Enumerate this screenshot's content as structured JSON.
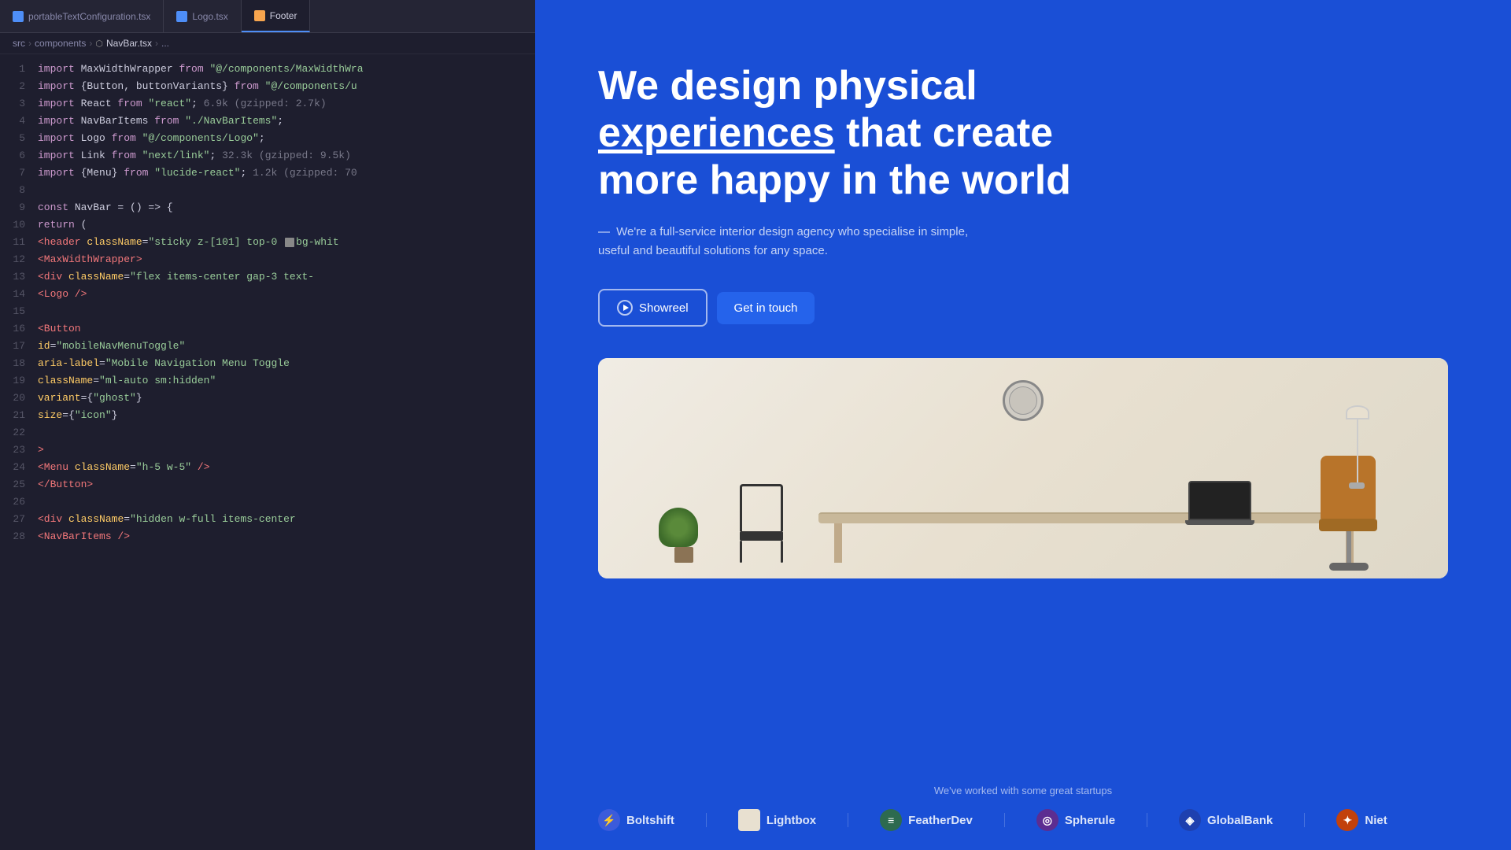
{
  "editor": {
    "tabs": [
      {
        "label": "portableTextConfiguration.tsx",
        "type": "tsx",
        "active": false
      },
      {
        "label": "Logo.tsx",
        "type": "tsx",
        "active": false
      },
      {
        "label": "Footer",
        "type": "partial",
        "active": true
      }
    ],
    "breadcrumb": {
      "parts": [
        "src",
        "components",
        "NavBar.tsx",
        "..."
      ]
    },
    "lines": [
      {
        "num": "1",
        "tokens": [
          {
            "t": "kw",
            "v": "import"
          },
          {
            "t": "cls",
            "v": " MaxWidthWrapper "
          },
          {
            "t": "kw",
            "v": "from"
          },
          {
            "t": "str",
            "v": " \"@/components/MaxWidthWra"
          }
        ]
      },
      {
        "num": "2",
        "tokens": [
          {
            "t": "kw",
            "v": "import"
          },
          {
            "t": "cls",
            "v": " {Button, buttonVariants} "
          },
          {
            "t": "kw",
            "v": "from"
          },
          {
            "t": "str",
            "v": " \"@/components/u"
          }
        ]
      },
      {
        "num": "3",
        "tokens": [
          {
            "t": "kw",
            "v": "import"
          },
          {
            "t": "cls",
            "v": " React "
          },
          {
            "t": "kw",
            "v": "from"
          },
          {
            "t": "str",
            "v": " \"react\""
          },
          {
            "t": "cmt",
            "v": ";  6.9k (gzipped: 2.7k)"
          }
        ]
      },
      {
        "num": "4",
        "tokens": [
          {
            "t": "kw",
            "v": "import"
          },
          {
            "t": "cls",
            "v": " NavBarItems "
          },
          {
            "t": "kw",
            "v": "from"
          },
          {
            "t": "str",
            "v": " \"./NavBarItems\""
          },
          {
            "t": "cls",
            "v": ";"
          }
        ]
      },
      {
        "num": "5",
        "tokens": [
          {
            "t": "kw",
            "v": "import"
          },
          {
            "t": "cls",
            "v": " Logo "
          },
          {
            "t": "kw",
            "v": "from"
          },
          {
            "t": "str",
            "v": " \"@/components/Logo\""
          },
          {
            "t": "cls",
            "v": ";"
          }
        ]
      },
      {
        "num": "6",
        "tokens": [
          {
            "t": "kw",
            "v": "import"
          },
          {
            "t": "cls",
            "v": " Link "
          },
          {
            "t": "kw",
            "v": "from"
          },
          {
            "t": "str",
            "v": " \"next/link\""
          },
          {
            "t": "cmt",
            "v": ";  32.3k (gzipped: 9.5k)"
          }
        ]
      },
      {
        "num": "7",
        "tokens": [
          {
            "t": "kw",
            "v": "import"
          },
          {
            "t": "cls",
            "v": " {Menu} "
          },
          {
            "t": "kw",
            "v": "from"
          },
          {
            "t": "str",
            "v": " \"lucide-react\""
          },
          {
            "t": "cmt",
            "v": ";  1.2k (gzipped: 70"
          }
        ]
      },
      {
        "num": "8",
        "tokens": []
      },
      {
        "num": "9",
        "tokens": [
          {
            "t": "kw",
            "v": "const"
          },
          {
            "t": "cls",
            "v": " NavBar "
          },
          {
            "t": "kw",
            "v": "= () =>"
          },
          {
            "t": "cls",
            "v": " {"
          }
        ]
      },
      {
        "num": "10",
        "tokens": [
          {
            "t": "cls",
            "v": "    "
          },
          {
            "t": "kw",
            "v": "return"
          },
          {
            "t": "cls",
            "v": " ("
          }
        ]
      },
      {
        "num": "11",
        "tokens": [
          {
            "t": "cls",
            "v": "        "
          },
          {
            "t": "tag",
            "v": "<header"
          },
          {
            "t": "cls",
            "v": " "
          },
          {
            "t": "attr",
            "v": "className"
          },
          {
            "t": "cls",
            "v": "="
          },
          {
            "t": "str",
            "v": "\"sticky z-[101] top-0  bg-whit"
          }
        ]
      },
      {
        "num": "12",
        "tokens": [
          {
            "t": "cls",
            "v": "            "
          },
          {
            "t": "tag",
            "v": "<MaxWidthWrapper"
          },
          {
            "t": "tag",
            "v": ">"
          }
        ]
      },
      {
        "num": "13",
        "tokens": [
          {
            "t": "cls",
            "v": "                "
          },
          {
            "t": "tag",
            "v": "<div"
          },
          {
            "t": "cls",
            "v": " "
          },
          {
            "t": "attr",
            "v": "className"
          },
          {
            "t": "cls",
            "v": "="
          },
          {
            "t": "str",
            "v": "\"flex items-center gap-3 text-"
          }
        ]
      },
      {
        "num": "14",
        "tokens": [
          {
            "t": "cls",
            "v": "                    "
          },
          {
            "t": "tag",
            "v": "<Logo"
          },
          {
            "t": "cls",
            "v": " "
          },
          {
            "t": "tag",
            "v": "/>"
          }
        ]
      },
      {
        "num": "15",
        "tokens": []
      },
      {
        "num": "16",
        "tokens": [
          {
            "t": "cls",
            "v": "                "
          },
          {
            "t": "tag",
            "v": "<Button"
          }
        ]
      },
      {
        "num": "17",
        "tokens": [
          {
            "t": "cls",
            "v": "                    "
          },
          {
            "t": "attr",
            "v": "id"
          },
          {
            "t": "cls",
            "v": "="
          },
          {
            "t": "str",
            "v": "\"mobileNavMenuToggle\""
          }
        ]
      },
      {
        "num": "18",
        "tokens": [
          {
            "t": "cls",
            "v": "                    "
          },
          {
            "t": "attr",
            "v": "aria-label"
          },
          {
            "t": "cls",
            "v": "="
          },
          {
            "t": "str",
            "v": "\"Mobile Navigation Menu Toggle"
          }
        ]
      },
      {
        "num": "19",
        "tokens": [
          {
            "t": "cls",
            "v": "                    "
          },
          {
            "t": "attr",
            "v": "className"
          },
          {
            "t": "cls",
            "v": "="
          },
          {
            "t": "str",
            "v": "\"ml-auto sm:hidden\""
          }
        ]
      },
      {
        "num": "20",
        "tokens": [
          {
            "t": "cls",
            "v": "                    "
          },
          {
            "t": "attr",
            "v": "variant"
          },
          {
            "t": "cls",
            "v": "={"
          },
          {
            "t": "str",
            "v": "\"ghost\""
          },
          {
            "t": "cls",
            "v": "}"
          }
        ]
      },
      {
        "num": "21",
        "tokens": [
          {
            "t": "cls",
            "v": "                    "
          },
          {
            "t": "attr",
            "v": "size"
          },
          {
            "t": "cls",
            "v": "={"
          },
          {
            "t": "str",
            "v": "\"icon\""
          },
          {
            "t": "cls",
            "v": "}"
          }
        ]
      },
      {
        "num": "22",
        "tokens": []
      },
      {
        "num": "23",
        "tokens": [
          {
            "t": "cls",
            "v": "                "
          },
          {
            "t": "tag",
            "v": ">"
          }
        ]
      },
      {
        "num": "24",
        "tokens": [
          {
            "t": "cls",
            "v": "                "
          },
          {
            "t": "tag",
            "v": "<Menu"
          },
          {
            "t": "cls",
            "v": " "
          },
          {
            "t": "attr",
            "v": "className"
          },
          {
            "t": "cls",
            "v": "="
          },
          {
            "t": "str",
            "v": "\"h-5 w-5\""
          },
          {
            "t": "cls",
            "v": " "
          },
          {
            "t": "tag",
            "v": "/>"
          }
        ]
      },
      {
        "num": "25",
        "tokens": [
          {
            "t": "cls",
            "v": "                "
          },
          {
            "t": "tag",
            "v": "</Button>"
          }
        ]
      },
      {
        "num": "26",
        "tokens": []
      },
      {
        "num": "27",
        "tokens": [
          {
            "t": "cls",
            "v": "                "
          },
          {
            "t": "tag",
            "v": "<div"
          },
          {
            "t": "cls",
            "v": " "
          },
          {
            "t": "attr",
            "v": "className"
          },
          {
            "t": "cls",
            "v": "="
          },
          {
            "t": "str",
            "v": "\"hidden w-full items-center"
          }
        ]
      },
      {
        "num": "28",
        "tokens": [
          {
            "t": "cls",
            "v": "                    "
          },
          {
            "t": "tag",
            "v": "<NavBarItems"
          },
          {
            "t": "cls",
            "v": " "
          },
          {
            "t": "tag",
            "v": "/>"
          }
        ]
      }
    ]
  },
  "preview": {
    "hero": {
      "title_part1": "We design physical ",
      "title_underlined": "experiences",
      "title_part2": " that create more happy in the world",
      "subtitle": "— We're a full-service interior design agency who specialise in simple, useful and beautiful solutions for any space.",
      "btn_showreel": "Showreel",
      "btn_contact": "Get in touch"
    },
    "brands": {
      "tagline": "We've worked with some great startups",
      "items": [
        {
          "name": "Boltshift",
          "icon": "⚡",
          "class": "boltshift"
        },
        {
          "name": "Lightbox",
          "icon": "◻",
          "class": "lightbox"
        },
        {
          "name": "FeatherDev",
          "icon": "≡",
          "class": "featherdev"
        },
        {
          "name": "Spherule",
          "icon": "◎",
          "class": "spherule"
        },
        {
          "name": "GlobalBank",
          "icon": "◈",
          "class": "globalbank"
        },
        {
          "name": "Niet",
          "icon": "✦",
          "class": "niet"
        }
      ]
    },
    "get_in_touch_overlay": "Get In touch"
  }
}
